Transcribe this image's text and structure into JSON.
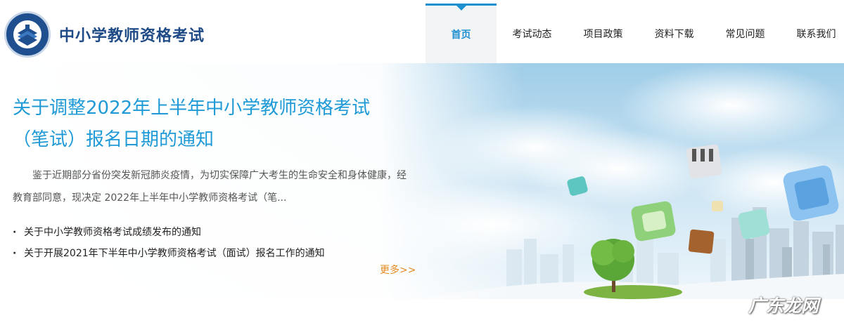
{
  "header": {
    "site_title": "中小学教师资格考试",
    "nav": [
      {
        "label": "首页",
        "active": true
      },
      {
        "label": "考试动态",
        "active": false
      },
      {
        "label": "项目政策",
        "active": false
      },
      {
        "label": "资料下载",
        "active": false
      },
      {
        "label": "常见问题",
        "active": false
      },
      {
        "label": "联系我们",
        "active": false
      }
    ]
  },
  "banner": {
    "headline": "关于调整2022年上半年中小学教师资格考试（笔试）报名日期的通知",
    "summary": "鉴于近期部分省份突发新冠肺炎疫情，为切实保障广大考生的生命安全和身体健康，经教育部同意，现决定 2022年上半年中小学教师资格考试（笔...",
    "links": [
      "关于中小学教师资格考试成绩发布的通知",
      "关于开展2021年下半年中小学教师资格考试（面试）报名工作的通知"
    ],
    "more_label": "更多>>"
  },
  "watermark": "广东龙网",
  "colors": {
    "brand_blue": "#1e4a86",
    "accent_blue": "#1f9ad6",
    "more_orange": "#e6891e",
    "nav_active_bg": "#f3f4f6"
  }
}
